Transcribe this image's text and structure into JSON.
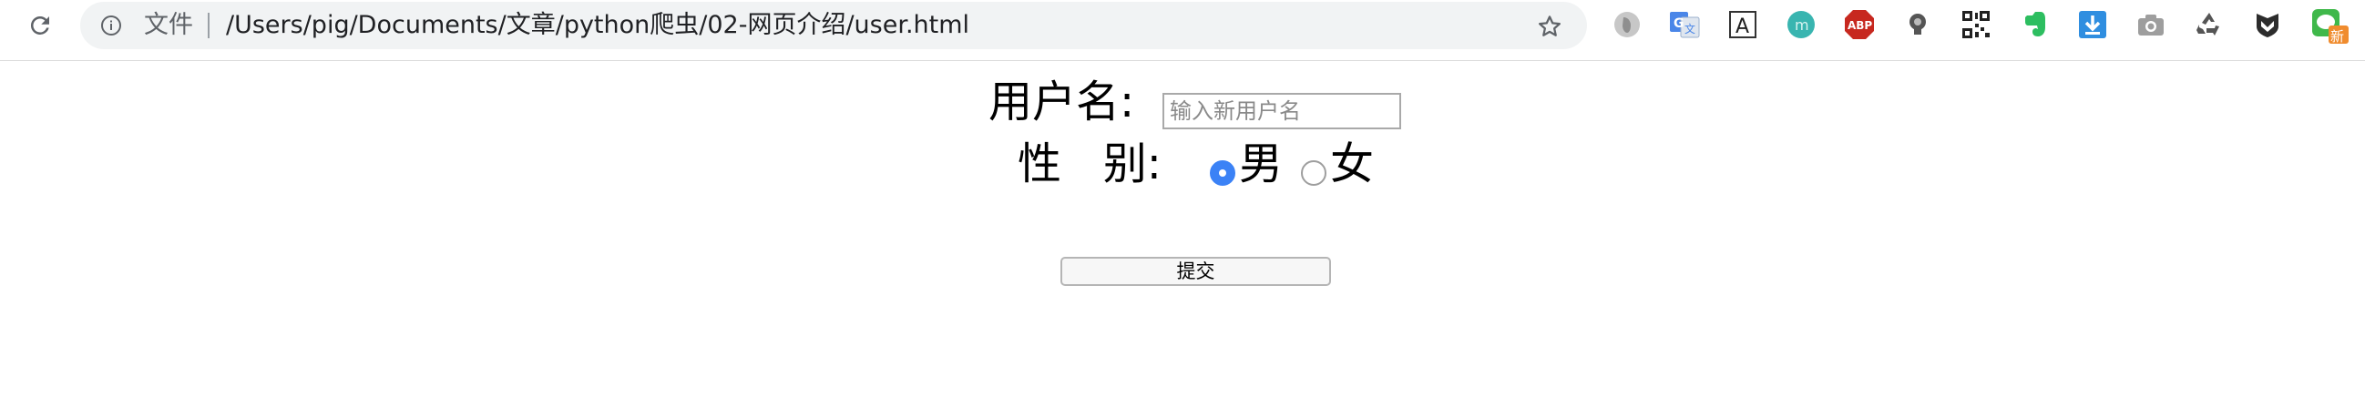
{
  "browser": {
    "scheme_label": "文件",
    "url": "/Users/pig/Documents/文章/python爬虫/02-网页介绍/user.html",
    "extensions": [
      {
        "name": "ghost-extension-icon"
      },
      {
        "name": "google-translate-icon"
      },
      {
        "name": "text-a-icon"
      },
      {
        "name": "teal-circle-extension-icon"
      },
      {
        "name": "abp-icon",
        "label": "ABP"
      },
      {
        "name": "lightbulb-icon"
      },
      {
        "name": "qr-code-icon"
      },
      {
        "name": "evernote-icon"
      },
      {
        "name": "download-icon"
      },
      {
        "name": "camera-icon"
      },
      {
        "name": "recycle-icon"
      },
      {
        "name": "shield-m-icon"
      },
      {
        "name": "wechat-new-icon",
        "label": "新"
      }
    ]
  },
  "form": {
    "username_label": "用户名:",
    "username_placeholder": "输入新用户名",
    "gender_label": "性   别:",
    "option_male": "男",
    "option_female": "女",
    "selected_gender": "男",
    "submit_label": "提交"
  },
  "colors": {
    "radio_selected": "#3b82f6",
    "omnibox_bg": "#f1f3f4"
  }
}
